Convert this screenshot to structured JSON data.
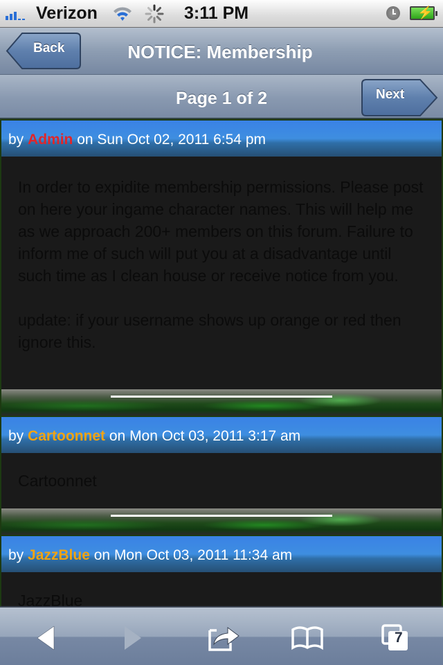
{
  "status_bar": {
    "carrier": "Verizon",
    "time": "3:11 PM",
    "icons": [
      "signal-icon",
      "wifi-icon",
      "activity-spinner-icon",
      "alarm-clock-icon",
      "battery-charging-icon"
    ]
  },
  "nav": {
    "title": "NOTICE: Membership",
    "back_label": "Back"
  },
  "pager": {
    "label": "Page 1 of 2",
    "next_label": "Next"
  },
  "colors": {
    "admin": "#e0262a",
    "member": "#f0a313",
    "header_blue": "#3a82e6"
  },
  "posts": [
    {
      "by": "by",
      "author": "Admin",
      "author_color": "#e0262a",
      "meta": "on Sun Oct 02, 2011 6:54 pm",
      "paragraphs": [
        "In order to expidite membership permissions. Please post on here your ingame character names. This will help me as we approach 200+ members on this forum. Failure to inform me of such will put you at a disadvantage until such time as I clean house or receive notice from you.",
        "update: if your username shows up orange or red then ignore this."
      ]
    },
    {
      "by": "by",
      "author": "Cartoonnet",
      "author_color": "#f0a313",
      "meta": "on Mon Oct 03, 2011 3:17 am",
      "paragraphs": [
        "Cartoonnet"
      ]
    },
    {
      "by": "by",
      "author": "JazzBlue",
      "author_color": "#f0a313",
      "meta": "on Mon Oct 03, 2011 11:34 am",
      "paragraphs": [
        "JazzBlue"
      ]
    }
  ],
  "toolbar": {
    "tabs_count": "7",
    "buttons": [
      "back-icon",
      "forward-icon",
      "share-icon",
      "bookmarks-icon",
      "tabs-icon"
    ]
  }
}
